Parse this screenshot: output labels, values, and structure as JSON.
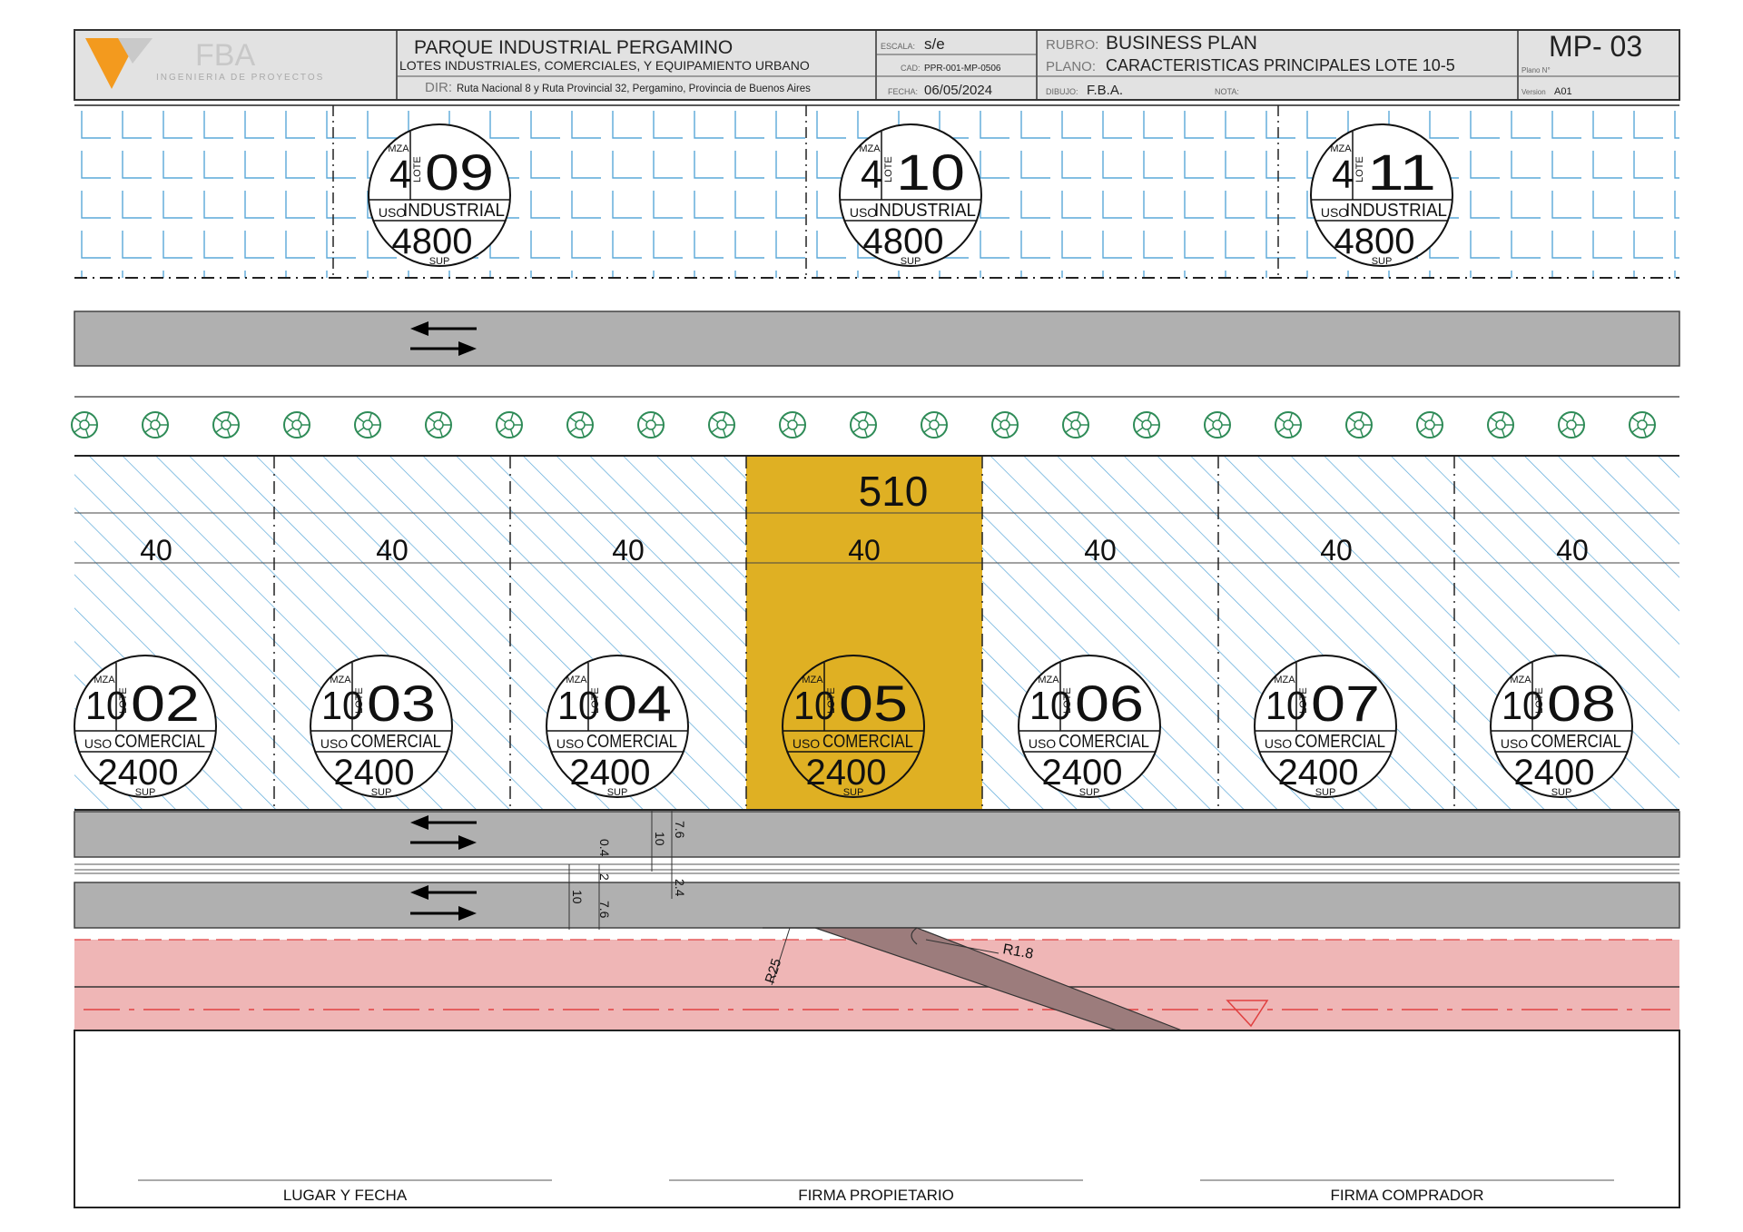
{
  "title_block": {
    "logo": {
      "text": "FBA",
      "subtitle": "INGENIERIA DE PROYECTOS",
      "accent": "#f39a1e"
    },
    "project": {
      "name": "PARQUE INDUSTRIAL PERGAMINO",
      "subtitle": "LOTES INDUSTRIALES, COMERCIALES, Y EQUIPAMIENTO URBANO",
      "dir_label": "DIR:",
      "dir_value": "Ruta Nacional 8 y Ruta Provincial 32, Pergamino, Provincia de Buenos Aires"
    },
    "escala_label": "ESCALA:",
    "escala_value": "s/e",
    "cad_label": "CAD:",
    "cad_value": "PPR-001-MP-0506",
    "fecha_label": "FECHA:",
    "fecha_value": "06/05/2024",
    "rubro_label": "RUBRO:",
    "rubro_value": "BUSINESS PLAN",
    "plano_label": "PLANO:",
    "plano_value": "CARACTERISTICAS PRINCIPALES LOTE 10-5",
    "dibujo_label": "DIBUJO:",
    "dibujo_value": "F.B.A.",
    "nota_label": "NOTA:",
    "plan_number": "MP- 03",
    "plan_number_label": "Plano N°",
    "version_label": "Version",
    "version_value": "A01"
  },
  "lot_labels": {
    "mza": "MZA",
    "lote": "LOTE",
    "uso": "USO",
    "sup": "SUP"
  },
  "top_lots": [
    {
      "mza": "4",
      "lote": "09",
      "uso": "INDUSTRIAL",
      "sup": "4800"
    },
    {
      "mza": "4",
      "lote": "10",
      "uso": "INDUSTRIAL",
      "sup": "4800"
    },
    {
      "mza": "4",
      "lote": "11",
      "uso": "INDUSTRIAL",
      "sup": "4800"
    }
  ],
  "bottom_lots": [
    {
      "mza": "10",
      "lote": "02",
      "uso": "COMERCIAL",
      "sup": "2400",
      "frente": "40",
      "highlight": false
    },
    {
      "mza": "10",
      "lote": "03",
      "uso": "COMERCIAL",
      "sup": "2400",
      "frente": "40",
      "highlight": false
    },
    {
      "mza": "10",
      "lote": "04",
      "uso": "COMERCIAL",
      "sup": "2400",
      "frente": "40",
      "highlight": false
    },
    {
      "mza": "10",
      "lote": "05",
      "uso": "COMERCIAL",
      "sup": "2400",
      "frente": "40",
      "highlight": true
    },
    {
      "mza": "10",
      "lote": "06",
      "uso": "COMERCIAL",
      "sup": "2400",
      "frente": "40",
      "highlight": false
    },
    {
      "mza": "10",
      "lote": "07",
      "uso": "COMERCIAL",
      "sup": "2400",
      "frente": "40",
      "highlight": false
    },
    {
      "mza": "10",
      "lote": "08",
      "uso": "COMERCIAL",
      "sup": "2400",
      "frente": "40",
      "highlight": false
    }
  ],
  "highlight_value": "510",
  "highlight_color": "#dfb023",
  "hatch_color": "#5aa8d8",
  "tree_color": "#2e8b57",
  "road_color": "#b0b0b0",
  "buffer_color": "#efb6b6",
  "dimensions": {
    "vertical_left": [
      "0.4",
      "2",
      "10",
      "7.6"
    ],
    "vertical_right": [
      "10",
      "7.6",
      "2.4"
    ],
    "radius_large": "R25",
    "radius_small": "R1.8"
  },
  "signatures": [
    "LUGAR Y FECHA",
    "FIRMA PROPIETARIO",
    "FIRMA COMPRADOR"
  ]
}
